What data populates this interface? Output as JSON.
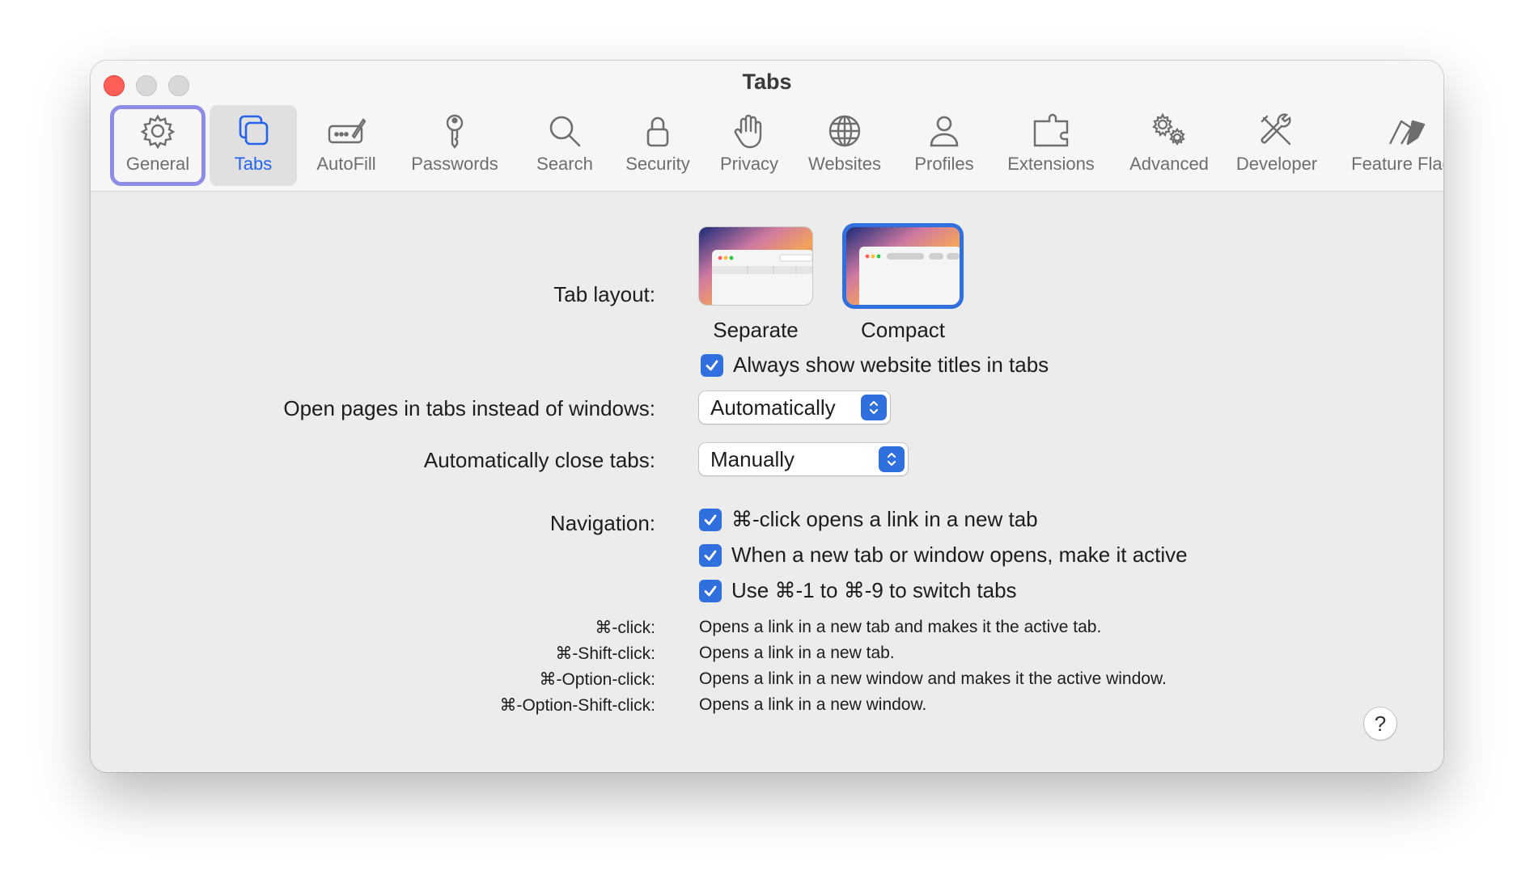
{
  "window": {
    "title": "Tabs"
  },
  "toolbar": {
    "items": [
      {
        "label": "General",
        "icon": "gear-icon"
      },
      {
        "label": "Tabs",
        "icon": "tabs-icon"
      },
      {
        "label": "AutoFill",
        "icon": "autofill-icon"
      },
      {
        "label": "Passwords",
        "icon": "key-icon"
      },
      {
        "label": "Search",
        "icon": "search-icon"
      },
      {
        "label": "Security",
        "icon": "lock-icon"
      },
      {
        "label": "Privacy",
        "icon": "hand-icon"
      },
      {
        "label": "Websites",
        "icon": "globe-icon"
      },
      {
        "label": "Profiles",
        "icon": "person-icon"
      },
      {
        "label": "Extensions",
        "icon": "puzzle-icon"
      },
      {
        "label": "Advanced",
        "icon": "gears-icon"
      },
      {
        "label": "Developer",
        "icon": "tools-icon"
      },
      {
        "label": "Feature Flags",
        "icon": "flags-icon"
      }
    ],
    "active": "Tabs",
    "focused": "General"
  },
  "tab_layout": {
    "label": "Tab layout:",
    "options": [
      {
        "label": "Separate",
        "selected": false
      },
      {
        "label": "Compact",
        "selected": true
      }
    ],
    "titles_checkbox": {
      "label": "Always show website titles in tabs",
      "checked": true
    }
  },
  "open_pages": {
    "label": "Open pages in tabs instead of windows:",
    "value": "Automatically"
  },
  "close_tabs": {
    "label": "Automatically close tabs:",
    "value": "Manually"
  },
  "navigation": {
    "label": "Navigation:",
    "options": [
      {
        "label": "⌘-click opens a link in a new tab",
        "checked": true
      },
      {
        "label": "When a new tab or window opens, make it active",
        "checked": true
      },
      {
        "label": "Use ⌘-1 to ⌘-9 to switch tabs",
        "checked": true
      }
    ]
  },
  "shortcuts": [
    {
      "key": "⌘-click:",
      "desc": "Opens a link in a new tab and makes it the active tab."
    },
    {
      "key": "⌘-Shift-click:",
      "desc": "Opens a link in a new tab."
    },
    {
      "key": "⌘-Option-click:",
      "desc": "Opens a link in a new window and makes it the active window."
    },
    {
      "key": "⌘-Option-Shift-click:",
      "desc": "Opens a link in a new window."
    }
  ],
  "help": {
    "label": "?"
  },
  "colors": {
    "accent": "#2f6fde",
    "focus_ring": "#8f8ce6",
    "close": "#ff5f57"
  }
}
